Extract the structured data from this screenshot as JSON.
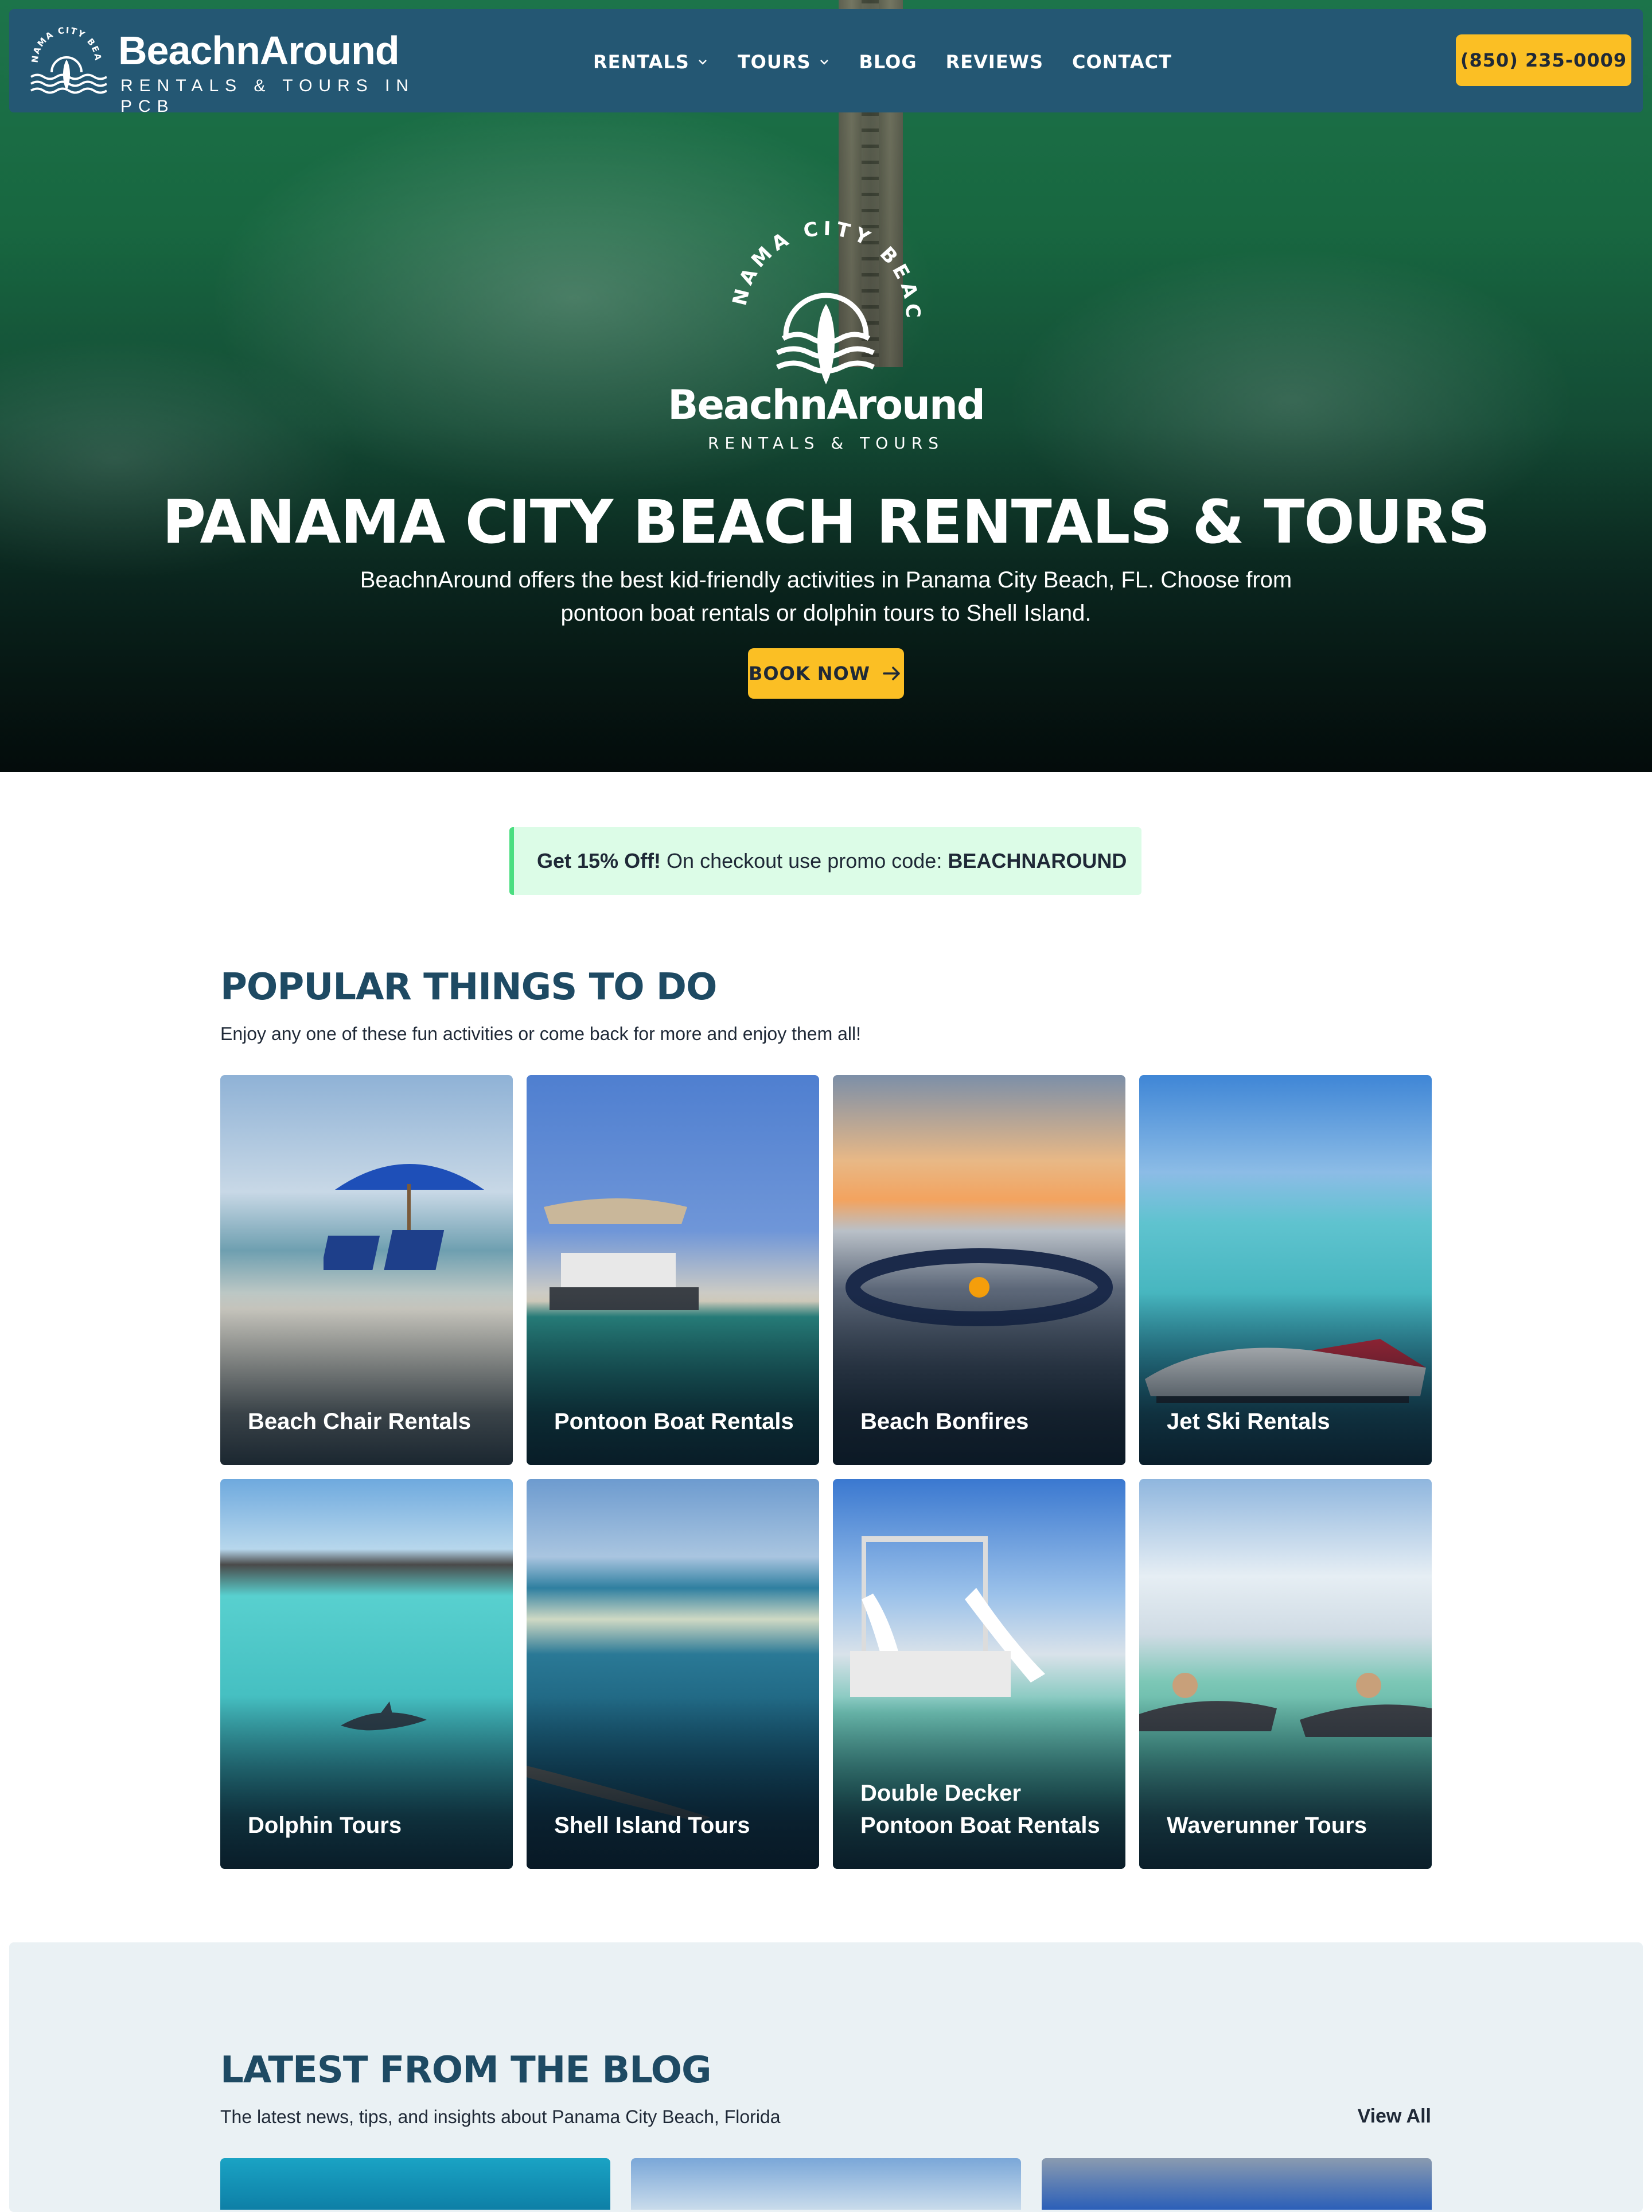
{
  "colors": {
    "nav_bg": "#245773",
    "accent_yellow": "#fbbf24",
    "heading_blue": "#1e4a63",
    "promo_bg": "#dcfce7",
    "promo_border": "#4ade80",
    "blog_bg": "#eaf1f4"
  },
  "header": {
    "logo_name": "BeachnAround",
    "logo_tagline": "RENTALS & TOURS IN PCB",
    "logo_arc_text": "PANAMA CITY BEACH",
    "nav": [
      {
        "label": "RENTALS",
        "icon": "chevron-down-icon"
      },
      {
        "label": "TOURS",
        "icon": "chevron-down-icon"
      },
      {
        "label": "BLOG"
      },
      {
        "label": "REVIEWS"
      },
      {
        "label": "CONTACT"
      }
    ],
    "phone": "(850) 235-0009"
  },
  "hero": {
    "logo_arc_text": "PANAMA CITY BEACH",
    "logo_name": "BeachnAround",
    "logo_tagline": "RENTALS & TOURS",
    "title": "PANAMA CITY BEACH RENTALS & TOURS",
    "subtitle": "BeachnAround offers the best kid-friendly activities in Panama City Beach, FL. Choose from pontoon boat rentals or dolphin tours to Shell Island.",
    "cta": "BOOK NOW",
    "cta_icon": "arrow-right-icon"
  },
  "promo": {
    "lead": "Get 15% Off!",
    "text": " On checkout use promo code: ",
    "code": "BEACHNAROUND"
  },
  "popular": {
    "title": "POPULAR THINGS TO DO",
    "subtitle": "Enjoy any one of these fun activities or come back for more and enjoy them all!",
    "items": [
      {
        "label": "Beach Chair Rentals"
      },
      {
        "label": "Pontoon Boat Rentals"
      },
      {
        "label": "Beach Bonfires"
      },
      {
        "label": "Jet Ski Rentals"
      },
      {
        "label": "Dolphin Tours"
      },
      {
        "label": "Shell Island Tours"
      },
      {
        "label": "Double Decker Pontoon Boat Rentals"
      },
      {
        "label": "Waverunner Tours"
      }
    ]
  },
  "blog": {
    "title": "LATEST FROM THE BLOG",
    "subtitle": "The latest news, tips, and insights about Panama City Beach, Florida",
    "view_all": "View All"
  }
}
